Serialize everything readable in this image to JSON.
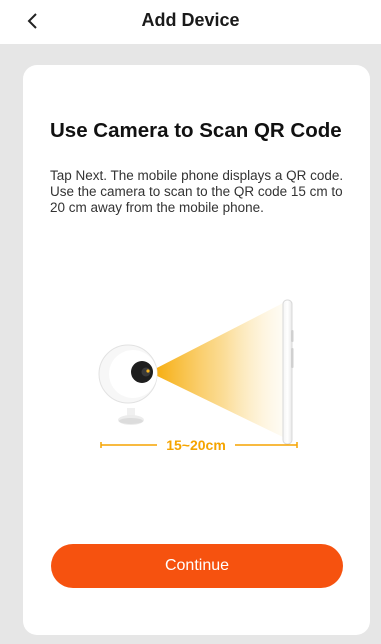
{
  "header": {
    "back_icon": "chevron-left-icon",
    "title": "Add Device"
  },
  "card": {
    "title": "Use Camera to Scan QR Code",
    "description": "Tap Next. The mobile phone displays a QR code. Use the camera to scan to the QR code 15 cm to 20 cm away from the mobile phone.",
    "distance_label": "15~20cm",
    "continue_label": "Continue"
  },
  "colors": {
    "accent": "#f6520f",
    "beam": "#f7b520",
    "background": "#e6e6e6"
  }
}
